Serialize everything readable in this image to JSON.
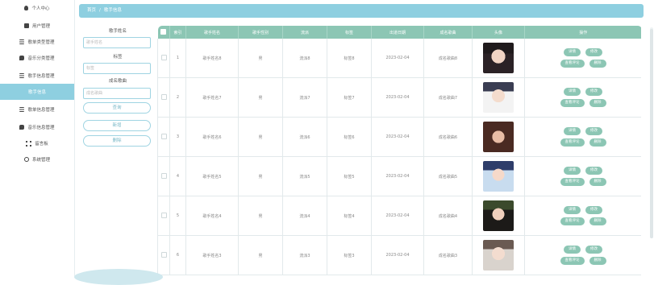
{
  "sidebar": {
    "items": [
      {
        "label": "个人中心",
        "icon": "user-icon",
        "active": false
      },
      {
        "label": "用户管理",
        "icon": "lock-icon",
        "active": false
      },
      {
        "label": "歌单类型管理",
        "icon": "list-icon",
        "active": false
      },
      {
        "label": "音乐分类管理",
        "icon": "chat-icon",
        "active": false
      },
      {
        "label": "歌手信息管理",
        "icon": "list-icon",
        "active": false
      },
      {
        "label": "歌手信息",
        "icon": "",
        "active": true
      },
      {
        "label": "歌单信息管理",
        "icon": "list-icon",
        "active": false
      },
      {
        "label": "音乐信息管理",
        "icon": "chat-icon",
        "active": false
      },
      {
        "label": "留言板",
        "icon": "grid-icon",
        "active": false
      },
      {
        "label": "系统管理",
        "icon": "gear-icon",
        "active": false
      }
    ]
  },
  "breadcrumb": {
    "home": "首页",
    "separator": "/",
    "current": "歌手信息"
  },
  "search": {
    "name_label": "歌手姓名",
    "name_placeholder": "歌手姓名",
    "tag_label": "标签",
    "tag_placeholder": "标签",
    "works_label": "成名歌曲",
    "works_placeholder": "成名歌曲",
    "query_button": "查询",
    "add_button": "新增",
    "delete_button": "删除"
  },
  "table": {
    "headers": [
      "",
      "索引",
      "歌手姓名",
      "歌手性别",
      "流派",
      "标签",
      "出道日期",
      "成名歌曲",
      "头像",
      "操作"
    ],
    "rows": [
      {
        "index": "1",
        "name": "歌手姓名8",
        "gender": "男",
        "genre": "流派8",
        "tag": "标签8",
        "date": "2023-02-04",
        "song": "成名歌曲8",
        "avatar": "avatar-girl-dark"
      },
      {
        "index": "2",
        "name": "歌手姓名7",
        "gender": "男",
        "genre": "流派7",
        "tag": "标签7",
        "date": "2023-02-04",
        "song": "成名歌曲7",
        "avatar": "avatar-boy-white"
      },
      {
        "index": "3",
        "name": "歌手姓名6",
        "gender": "男",
        "genre": "流派6",
        "tag": "标签6",
        "date": "2023-02-04",
        "song": "成名歌曲6",
        "avatar": "avatar-girl-warm"
      },
      {
        "index": "4",
        "name": "歌手姓名5",
        "gender": "男",
        "genre": "流派5",
        "tag": "标签5",
        "date": "2023-02-04",
        "song": "成名歌曲5",
        "avatar": "avatar-boy-blue"
      },
      {
        "index": "5",
        "name": "歌手姓名4",
        "gender": "男",
        "genre": "流派4",
        "tag": "标签4",
        "date": "2023-02-04",
        "song": "成名歌曲4",
        "avatar": "avatar-girl-green"
      },
      {
        "index": "6",
        "name": "歌手姓名3",
        "gender": "男",
        "genre": "流派3",
        "tag": "标签3",
        "date": "2023-02-04",
        "song": "成名歌曲3",
        "avatar": "avatar-girl-light"
      }
    ],
    "ops": {
      "detail": "详情",
      "edit": "修改",
      "comments": "查看评论",
      "delete": "删除"
    }
  },
  "colors": {
    "accent": "#8ecfe0",
    "table_header": "#8cc6b4"
  }
}
